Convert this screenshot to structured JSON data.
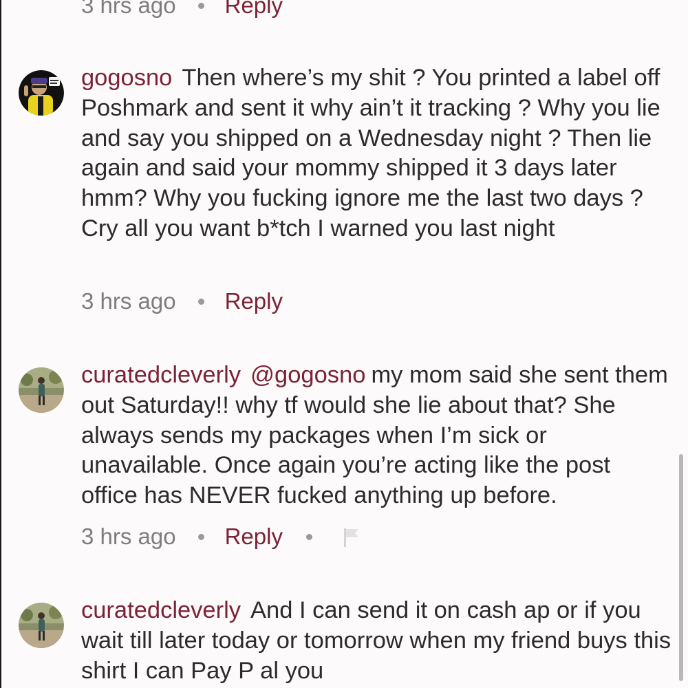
{
  "colors": {
    "accent": "#7b2336",
    "muted_text": "#7d7d7d",
    "body_text": "#2b2b2b",
    "background": "#fcfafa"
  },
  "top_meta": {
    "time": "3 hrs ago",
    "reply_label": "Reply"
  },
  "comments": [
    {
      "username": "gogosno",
      "avatar_icon": "cartoon-avatar-icon",
      "mention": "",
      "text": "Then where’s my shit ? You printed a label off Poshmark and sent it why ain’t it tracking ? Why you lie and say you shipped on a Wednesday night ? Then lie again and said your mommy shipped it 3 days later hmm? Why you fucking ignore me the last two days ? Cry all you want b*tch I warned you last night",
      "time": "3 hrs ago",
      "reply_label": "Reply"
    },
    {
      "username": "curatedcleverly",
      "avatar_icon": "photo-avatar-icon",
      "mention": "@gogosno",
      "text": "my mom said she sent them out Saturday!! why tf would she lie about that? She always sends my packages when I’m sick or unavailable. Once again you’re acting like the post office has NEVER fucked anything up before.",
      "time": "3 hrs ago",
      "reply_label": "Reply",
      "flag_icon": "flag-icon"
    },
    {
      "username": "curatedcleverly",
      "avatar_icon": "photo-avatar-icon",
      "mention": "",
      "text": "And I can send it on cash ap or if you wait till later today or tomorrow when my friend buys this shirt I can Pay P al you"
    }
  ]
}
